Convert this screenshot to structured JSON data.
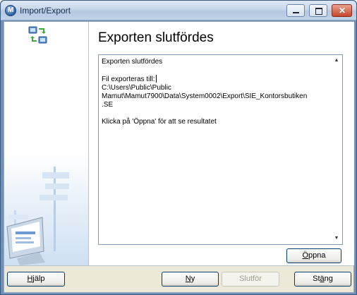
{
  "window": {
    "title": "Import/Export",
    "icon": "mamut-app-icon"
  },
  "title_bar_buttons": {
    "minimize_icon": "minimize-icon",
    "maximize_icon": "maximize-icon",
    "close_icon": "close-icon"
  },
  "main": {
    "heading": "Exporten slutfördes",
    "log_lines": [
      "Exporten slutfördes",
      "",
      "Fil exporteras till:",
      "C:\\Users\\Public\\Public",
      "Mamut\\Mamut7900\\Data\\System0002\\Export\\SIE_Kontorsbutiken",
      ".SE",
      "",
      "Klicka på 'Öppna' för att se resultatet"
    ],
    "open_button": {
      "prefix": "",
      "accel": "Ö",
      "rest": "ppna"
    }
  },
  "footer": {
    "help_button": {
      "prefix": "",
      "accel": "H",
      "rest": "jälp"
    },
    "new_button": {
      "prefix": "",
      "accel": "N",
      "rest": "y"
    },
    "finish_button": {
      "label": "Slutför",
      "enabled": false
    },
    "close_button": {
      "prefix": "St",
      "accel": "ä",
      "rest": "ng"
    }
  },
  "left_panel": {
    "top_icon": "network-exchange-icon",
    "bottom_illustration": "monitor-signpost-illustration"
  }
}
